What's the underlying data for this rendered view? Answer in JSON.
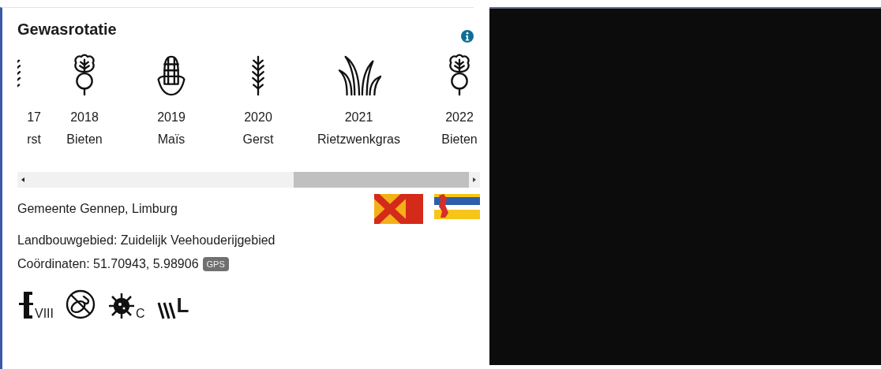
{
  "card": {
    "title": "Gewasrotatie",
    "rotation": [
      {
        "kind": "wheat",
        "year": "17",
        "crop": "rst",
        "clipped": true
      },
      {
        "kind": "beet",
        "year": "2018",
        "crop": "Bieten",
        "clipped": false
      },
      {
        "kind": "corn",
        "year": "2019",
        "crop": "Maïs",
        "clipped": false
      },
      {
        "kind": "wheat",
        "year": "2020",
        "crop": "Gerst",
        "clipped": false
      },
      {
        "kind": "grass",
        "year": "2021",
        "crop": "Rietzwenkgras",
        "clipped": false
      },
      {
        "kind": "beet",
        "year": "2022",
        "crop": "Bieten",
        "clipped": false
      }
    ],
    "municipality": "Gemeente Gennep, Limburg",
    "region": "Landbouwgebied: Zuidelijk Veehouderijgebied",
    "coordinates": "Coördinaten: 51.70943, 5.98906",
    "gps_badge": "GPS",
    "indicators": [
      {
        "kind": "soil",
        "label": "VIII"
      },
      {
        "kind": "no-potato"
      },
      {
        "kind": "virus",
        "label": "C"
      },
      {
        "kind": "slope",
        "label": "L"
      }
    ]
  }
}
